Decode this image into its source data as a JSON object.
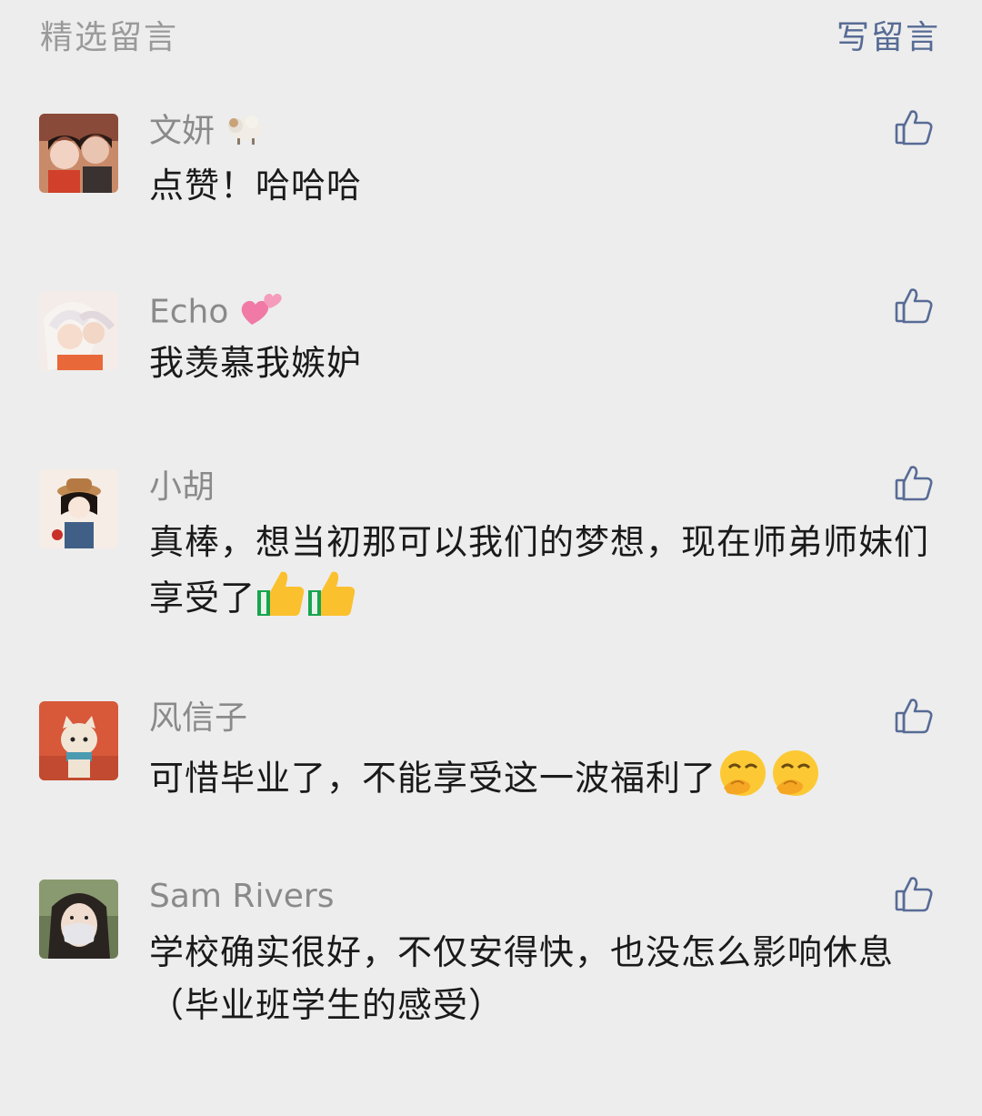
{
  "header": {
    "title": "精选留言",
    "write_label": "写留言"
  },
  "comments": [
    {
      "nickname": "文妍",
      "nick_emoji": "sheep",
      "text": "点赞！哈哈哈",
      "text_emoji": []
    },
    {
      "nickname": "Echo",
      "nick_emoji": "two-hearts",
      "text": "我羡慕我嫉妒",
      "text_emoji": []
    },
    {
      "nickname": "小胡",
      "nick_emoji": "",
      "text": "真棒，想当初那可以我们的梦想，现在师弟师妹们享受了",
      "text_emoji": [
        "thumbs-up",
        "thumbs-up"
      ]
    },
    {
      "nickname": "风信子",
      "nick_emoji": "",
      "text": "可惜毕业了，不能享受这一波福利了",
      "text_emoji": [
        "hmm-face",
        "hmm-face"
      ]
    },
    {
      "nickname": "Sam Rivers",
      "nick_emoji": "",
      "text": "学校确实很好，不仅安得快，也没怎么影响休息（毕业班学生的感受）",
      "text_emoji": []
    }
  ],
  "colors": {
    "background": "#ededed",
    "link": "#576b95",
    "nickname": "#8a8a8a",
    "text": "#1a1a1a",
    "muted": "#9a9a9a"
  }
}
